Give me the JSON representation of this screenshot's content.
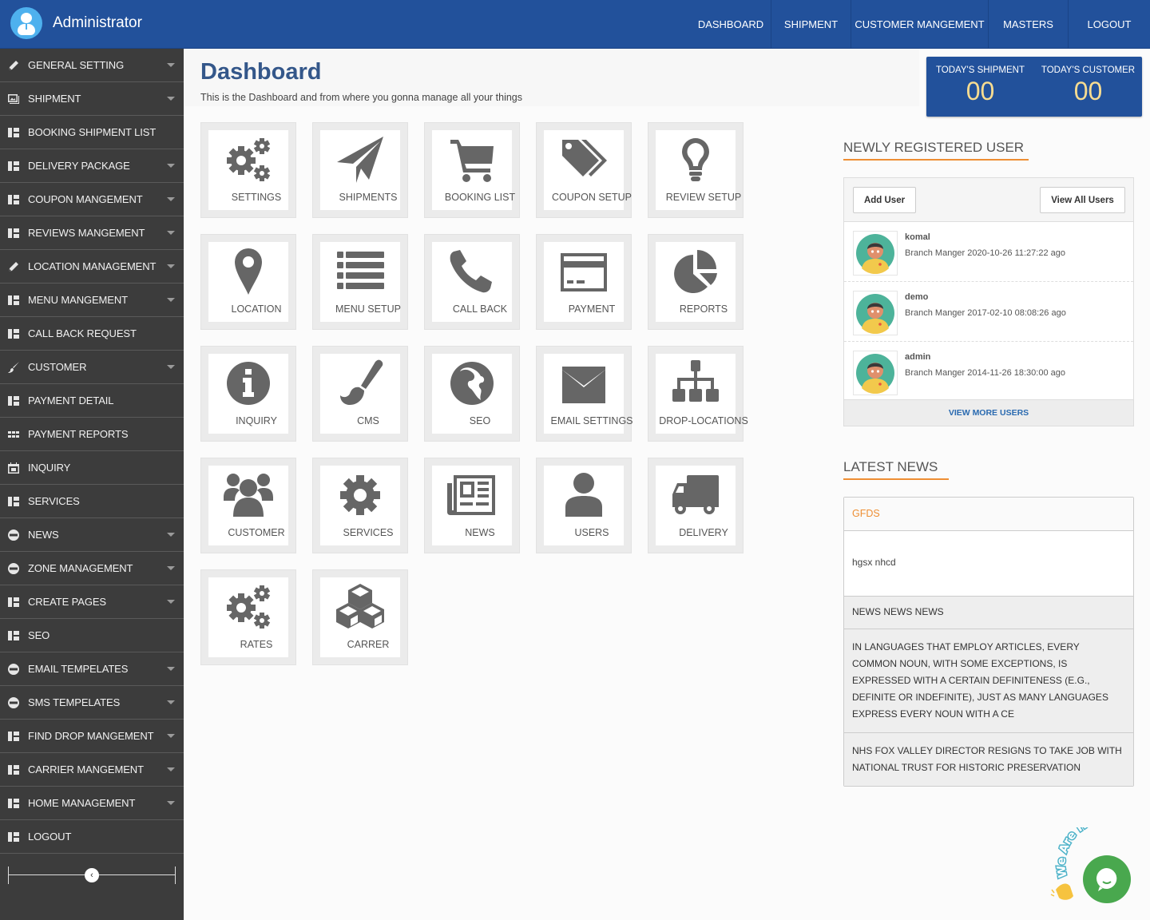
{
  "header": {
    "brand_name": "Administrator",
    "nav": [
      "DASHBOARD",
      "SHIPMENT",
      "CUSTOMER MANGEMENT",
      "MASTERS",
      "LOGOUT"
    ]
  },
  "sidebar": {
    "items": [
      {
        "label": "GENERAL SETTING",
        "icon": "pencil-icon",
        "caret": true
      },
      {
        "label": "SHIPMENT",
        "icon": "picture-icon",
        "caret": true
      },
      {
        "label": "BOOKING SHIPMENT LIST",
        "icon": "layout-icon",
        "caret": false
      },
      {
        "label": "DELIVERY PACKAGE",
        "icon": "layout-icon",
        "caret": true
      },
      {
        "label": "COUPON MANGEMENT",
        "icon": "layout-icon",
        "caret": true
      },
      {
        "label": "REVIEWS MANGEMENT",
        "icon": "layout-icon",
        "caret": true
      },
      {
        "label": "LOCATION MANAGEMENT",
        "icon": "pencil-icon",
        "caret": true
      },
      {
        "label": "MENU MANGEMENT",
        "icon": "layout-icon",
        "caret": true
      },
      {
        "label": "CALL BACK REQUEST",
        "icon": "layout-icon",
        "caret": false
      },
      {
        "label": "CUSTOMER",
        "icon": "brush-icon",
        "caret": true
      },
      {
        "label": "PAYMENT DETAIL",
        "icon": "layout-icon",
        "caret": false
      },
      {
        "label": "PAYMENT REPORTS",
        "icon": "grid-icon",
        "caret": false
      },
      {
        "label": "INQUIRY",
        "icon": "calendar-icon",
        "caret": false
      },
      {
        "label": "SERVICES",
        "icon": "layout-icon",
        "caret": false
      },
      {
        "label": "NEWS",
        "icon": "minus-circle-icon",
        "caret": true
      },
      {
        "label": "ZONE MANAGEMENT",
        "icon": "minus-circle-icon",
        "caret": true
      },
      {
        "label": "CREATE PAGES",
        "icon": "layout-icon",
        "caret": true
      },
      {
        "label": "SEO",
        "icon": "layout-icon",
        "caret": false
      },
      {
        "label": "EMAIL TEMPELATES",
        "icon": "minus-circle-icon",
        "caret": true
      },
      {
        "label": "SMS TEMPELATES",
        "icon": "minus-circle-icon",
        "caret": true
      },
      {
        "label": "FIND DROP MANGEMENT",
        "icon": "layout-icon",
        "caret": true
      },
      {
        "label": "CARRIER MANGEMENT",
        "icon": "layout-icon",
        "caret": true
      },
      {
        "label": "HOME MANAGEMENT",
        "icon": "layout-icon",
        "caret": true
      },
      {
        "label": "LOGOUT",
        "icon": "layout-icon",
        "caret": false
      }
    ],
    "collapse_icon": "‹"
  },
  "page": {
    "title": "Dashboard",
    "subtitle": "This is the Dashboard and from where you gonna manage all your things"
  },
  "stats": [
    {
      "label": "TODAY'S SHIPMENT",
      "value": "00"
    },
    {
      "label": "TODAY'S CUSTOMER",
      "value": "00"
    }
  ],
  "tiles": [
    {
      "label": "SETTINGS",
      "icon": "gears-icon"
    },
    {
      "label": "SHIPMENTS",
      "icon": "paper-plane-icon"
    },
    {
      "label": "BOOKING LIST",
      "icon": "shopping-cart-icon"
    },
    {
      "label": "COUPON SETUP",
      "icon": "tags-icon"
    },
    {
      "label": "REVIEW SETUP",
      "icon": "lightbulb-icon"
    },
    {
      "label": "LOCATION",
      "icon": "map-marker-icon"
    },
    {
      "label": "MENU SETUP",
      "icon": "list-icon"
    },
    {
      "label": "CALL BACK",
      "icon": "phone-icon"
    },
    {
      "label": "PAYMENT",
      "icon": "credit-card-icon"
    },
    {
      "label": "REPORTS",
      "icon": "pie-chart-icon"
    },
    {
      "label": "INQUIRY",
      "icon": "info-icon"
    },
    {
      "label": "CMS",
      "icon": "paint-brush-icon"
    },
    {
      "label": "SEO",
      "icon": "globe-icon"
    },
    {
      "label": "EMAIL SETTINGS",
      "icon": "envelope-icon"
    },
    {
      "label": "DROP-LOCATIONS",
      "icon": "sitemap-icon"
    },
    {
      "label": "CUSTOMER",
      "icon": "users-icon"
    },
    {
      "label": "SERVICES",
      "icon": "gear-icon"
    },
    {
      "label": "NEWS",
      "icon": "newspaper-icon"
    },
    {
      "label": "USERS",
      "icon": "user-icon"
    },
    {
      "label": "DELIVERY",
      "icon": "truck-icon"
    },
    {
      "label": "RATES",
      "icon": "gears-icon"
    },
    {
      "label": "CARRER",
      "icon": "cubes-icon"
    }
  ],
  "users_section": {
    "title": "NEWLY REGISTERED USER",
    "add_button": "Add User",
    "view_all_button": "View All Users",
    "users": [
      {
        "name": "komal",
        "meta": "Branch Manger 2020-10-26 11:27:22 ago"
      },
      {
        "name": "demo",
        "meta": "Branch Manger 2017-02-10 08:08:26 ago"
      },
      {
        "name": "admin",
        "meta": "Branch Manger 2014-11-26 18:30:00 ago"
      }
    ],
    "view_more": "VIEW MORE USERS"
  },
  "news_section": {
    "title": "LATEST NEWS",
    "headline": "GFDS",
    "body": "hgsx nhcd",
    "items": [
      "NEWS NEWS NEWS",
      "IN LANGUAGES THAT EMPLOY ARTICLES, EVERY COMMON NOUN, WITH SOME EXCEPTIONS, IS EXPRESSED WITH A CERTAIN DEFINITENESS (E.G., DEFINITE OR INDEFINITE), JUST AS MANY LANGUAGES EXPRESS EVERY NOUN WITH A CE",
      "NHS FOX VALLEY DIRECTOR RESIGNS TO TAKE JOB WITH NATIONAL TRUST FOR HISTORIC PRESERVATION"
    ]
  },
  "chat_widget": {
    "text": "We Are Here!"
  },
  "colors": {
    "header_blue": "#22519b",
    "sidebar_bg": "#3c3c3c",
    "accent_orange": "#ee8e33",
    "stat_value": "#f7dc91",
    "chat_green": "#49a84e"
  }
}
